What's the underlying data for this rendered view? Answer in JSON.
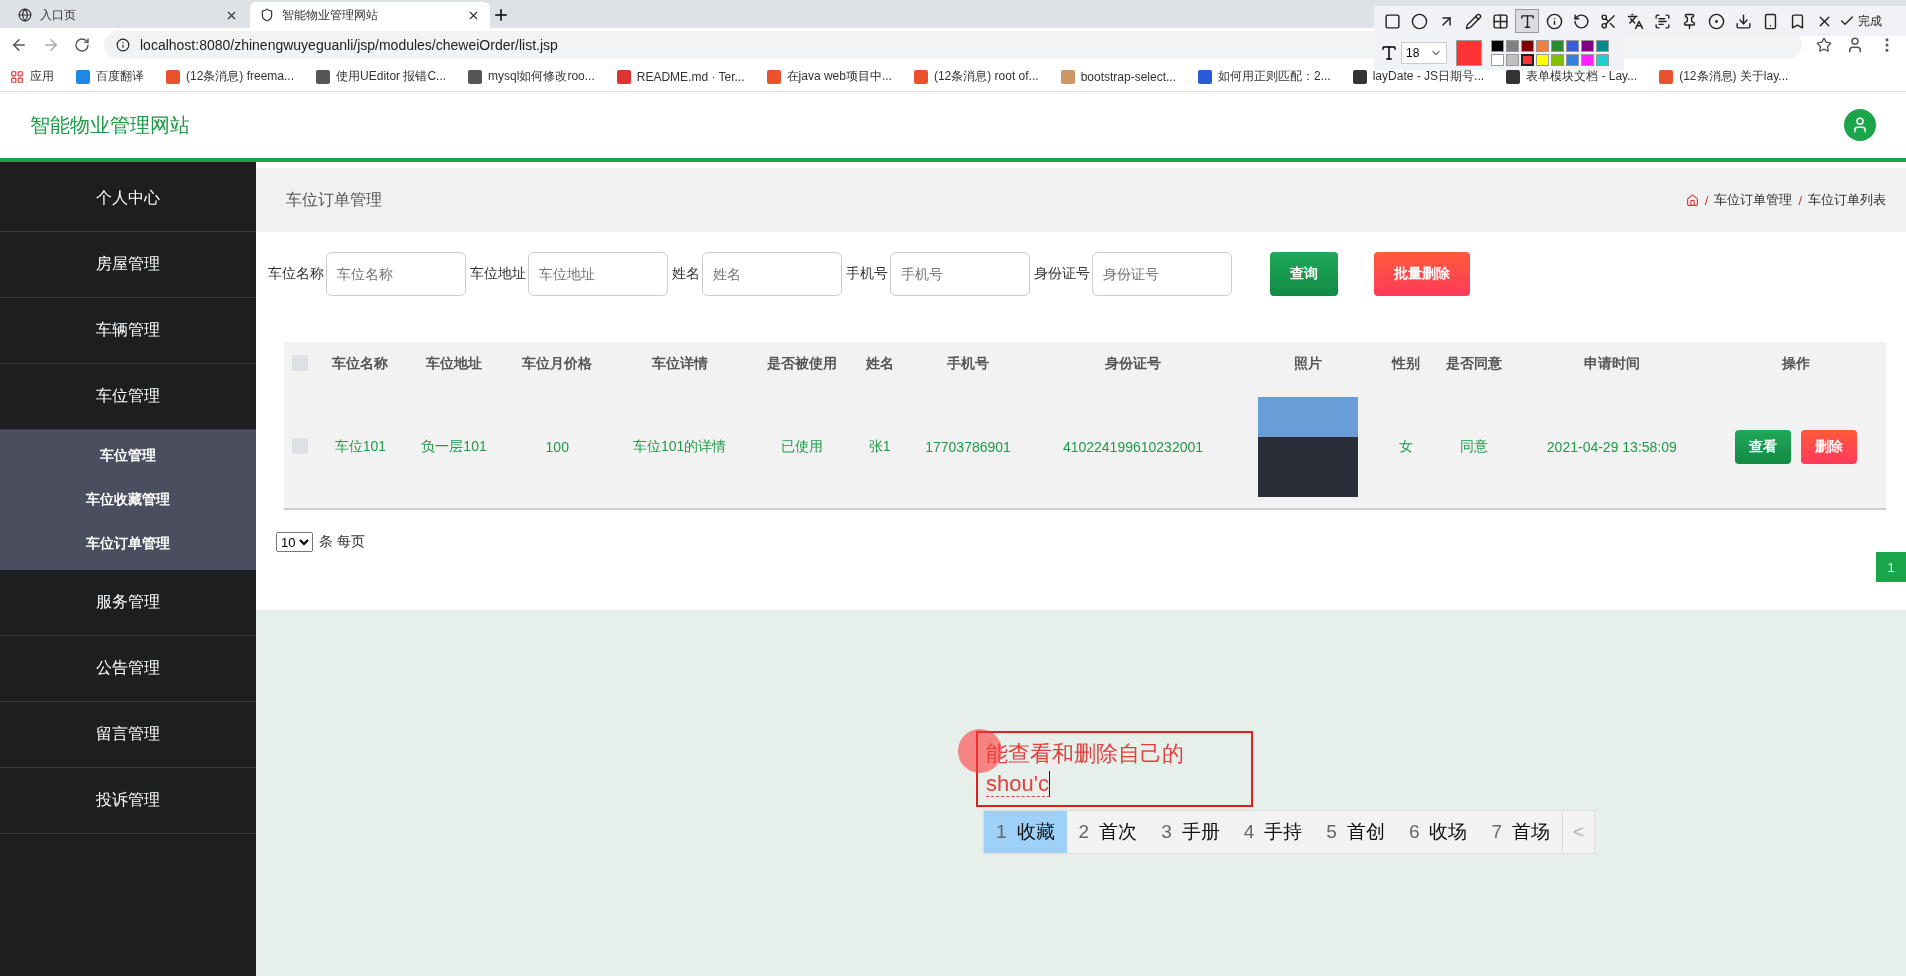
{
  "browser": {
    "tabs": [
      {
        "title": "入口页",
        "selected": false
      },
      {
        "title": "智能物业管理网站",
        "selected": true
      }
    ],
    "url": "localhost:8080/zhinengwuyeguanli/jsp/modules/cheweiOrder/list.jsp",
    "bookmarks": [
      "应用",
      "百度翻译",
      "(12条消息) freema...",
      "使用UEditor 报错C...",
      "mysql如何修改roo...",
      "README.md · Ter...",
      "在java web项目中...",
      "(12条消息) root of...",
      "bootstrap-select...",
      "如何用正则匹配：2...",
      "layDate - JS日期号...",
      "表单模块文档 - Lay...",
      "(12条消息) 关于lay..."
    ]
  },
  "header": {
    "site_title": "智能物业管理网站"
  },
  "sidebar": {
    "items": [
      {
        "label": "个人中心"
      },
      {
        "label": "房屋管理"
      },
      {
        "label": "车辆管理"
      },
      {
        "label": "车位管理",
        "children": [
          {
            "label": "车位管理"
          },
          {
            "label": "车位收藏管理"
          },
          {
            "label": "车位订单管理"
          }
        ]
      },
      {
        "label": "服务管理"
      },
      {
        "label": "公告管理"
      },
      {
        "label": "留言管理"
      },
      {
        "label": "投诉管理"
      }
    ]
  },
  "page": {
    "title": "车位订单管理",
    "breadcrumb": [
      {
        "sep": "/",
        "label": "车位订单管理"
      },
      {
        "sep": "/",
        "label": "车位订单列表"
      }
    ]
  },
  "filters": [
    {
      "label": "车位名称",
      "placeholder": "车位名称"
    },
    {
      "label": "车位地址",
      "placeholder": "车位地址"
    },
    {
      "label": "姓名",
      "placeholder": "姓名"
    },
    {
      "label": "手机号",
      "placeholder": "手机号"
    },
    {
      "label": "身份证号",
      "placeholder": "身份证号"
    }
  ],
  "filter_buttons": [
    {
      "label": "查询",
      "kind": "primary"
    },
    {
      "label": "批量删除",
      "kind": "danger"
    }
  ],
  "table": {
    "select_all_checked": false,
    "columns": [
      "车位名称",
      "车位地址",
      "车位月价格",
      "车位详情",
      "是否被使用",
      "姓名",
      "手机号",
      "身份证号",
      "照片",
      "性别",
      "是否同意",
      "申请时间",
      "操作"
    ],
    "rows": [
      {
        "checked": false,
        "cells": [
          "车位101",
          "负一层101",
          "100",
          "车位101的详情",
          "已使用",
          "张1",
          "17703786901",
          "410224199610232001",
          "",
          "女",
          "同意",
          "2021-04-29 13:58:09"
        ],
        "actions": [
          {
            "label": "查看",
            "kind": "primary"
          },
          {
            "label": "删除",
            "kind": "danger"
          }
        ]
      }
    ]
  },
  "pagination": {
    "page_size": "10",
    "page_size_suffix": "条 每页",
    "pages": [
      {
        "label": "1",
        "selected": true
      }
    ]
  },
  "annotation": {
    "text": "能查看和删除自己的",
    "composing": "shou'c"
  },
  "ime": {
    "candidates": [
      {
        "num": "1",
        "word": "收藏",
        "selected": true
      },
      {
        "num": "2",
        "word": "首次",
        "selected": false
      },
      {
        "num": "3",
        "word": "手册",
        "selected": false
      },
      {
        "num": "4",
        "word": "手持",
        "selected": false
      },
      {
        "num": "5",
        "word": "首创",
        "selected": false
      },
      {
        "num": "6",
        "word": "收场",
        "selected": false
      },
      {
        "num": "7",
        "word": "首场",
        "selected": false
      }
    ],
    "prev": "<"
  },
  "capture_toolbar": {
    "tools": [
      {
        "kind": "rect",
        "selected": false
      },
      {
        "kind": "circle",
        "selected": false
      },
      {
        "kind": "arrow",
        "selected": false
      },
      {
        "kind": "pen",
        "selected": false
      },
      {
        "kind": "mosaic",
        "selected": false
      },
      {
        "kind": "text",
        "selected": true
      },
      {
        "kind": "number",
        "selected": false
      },
      {
        "kind": "undo",
        "selected": false
      },
      {
        "kind": "cut",
        "selected": false
      },
      {
        "kind": "translate",
        "selected": false
      },
      {
        "kind": "ocr",
        "selected": false
      },
      {
        "kind": "pin",
        "selected": false
      },
      {
        "kind": "record",
        "selected": false
      },
      {
        "kind": "download",
        "selected": false
      },
      {
        "kind": "phone",
        "selected": false
      },
      {
        "kind": "bookmark",
        "selected": false
      },
      {
        "kind": "close",
        "selected": false
      }
    ],
    "done": "完成",
    "font_size": "18",
    "palette": [
      {
        "color": "#000000",
        "selected": false
      },
      {
        "color": "#808080",
        "selected": false
      },
      {
        "color": "#800000",
        "selected": false
      },
      {
        "color": "#f08040",
        "selected": false
      },
      {
        "color": "#2e8b2e",
        "selected": false
      },
      {
        "color": "#3b5bdb",
        "selected": false
      },
      {
        "color": "#800080",
        "selected": false
      },
      {
        "color": "#008b8b",
        "selected": false
      },
      {
        "color": "#ffffff",
        "selected": false
      },
      {
        "color": "#c0c0c0",
        "selected": false
      },
      {
        "color": "#ff3333",
        "selected": true
      },
      {
        "color": "#ffff00",
        "selected": false
      },
      {
        "color": "#80c000",
        "selected": false
      },
      {
        "color": "#3080e0",
        "selected": false
      },
      {
        "color": "#ff20ff",
        "selected": false
      },
      {
        "color": "#20d0d0",
        "selected": false
      }
    ]
  }
}
